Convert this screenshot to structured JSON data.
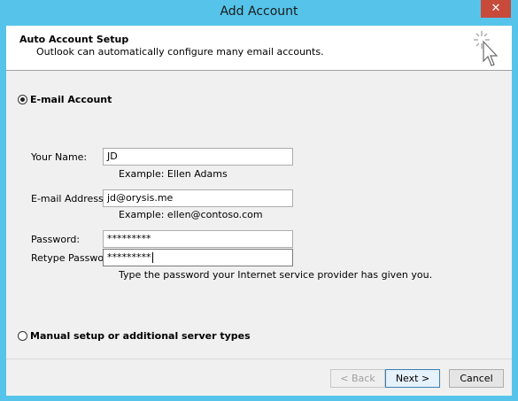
{
  "window": {
    "title": "Add Account",
    "close_label": "✕"
  },
  "header": {
    "title": "Auto Account Setup",
    "subtitle": "Outlook can automatically configure many email accounts."
  },
  "email_account": {
    "option_label": "E-mail Account",
    "selected": true,
    "your_name": {
      "label": "Your Name:",
      "value": "JD",
      "example": "Example: Ellen Adams"
    },
    "email_address": {
      "label": "E-mail Address:",
      "value": "jd@orysis.me",
      "example": "Example: ellen@contoso.com"
    },
    "password": {
      "label": "Password:",
      "value": "*********"
    },
    "retype_password": {
      "label": "Retype Password:",
      "value": "*********"
    },
    "password_hint": "Type the password your Internet service provider has given you."
  },
  "manual_setup": {
    "option_label": "Manual setup or additional server types",
    "selected": false
  },
  "buttons": {
    "back": "< Back",
    "next": "Next >",
    "cancel": "Cancel"
  },
  "icons": {
    "header": "wand-cursor-icon"
  }
}
